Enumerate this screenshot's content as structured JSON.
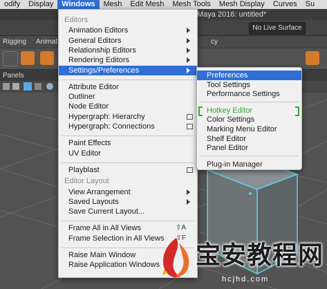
{
  "menubar": {
    "items": [
      "odify",
      "Display",
      "Windows",
      "Mesh",
      "Edit Mesh",
      "Mesh Tools",
      "Mesh Display",
      "Curves",
      "Su"
    ],
    "active_index": 2
  },
  "window_title": "Maya 2016: untitled*",
  "toolbar": {
    "live_surface": "No Live Surface"
  },
  "shelf_tabs": [
    "Rigging",
    "Animat",
    "cy"
  ],
  "panels_label": "Panels",
  "main_menu": {
    "sections": [
      {
        "header": "Editors",
        "items": [
          {
            "label": "Animation Editors",
            "kind": "submenu"
          },
          {
            "label": "General Editors",
            "kind": "submenu"
          },
          {
            "label": "Relationship Editors",
            "kind": "submenu"
          },
          {
            "label": "Rendering Editors",
            "kind": "submenu"
          },
          {
            "label": "Settings/Preferences",
            "kind": "submenu",
            "highlight": true
          }
        ]
      },
      {
        "header": "",
        "items": [
          {
            "label": "Attribute Editor"
          },
          {
            "label": "Outliner"
          },
          {
            "label": "Node Editor"
          },
          {
            "label": "Hypergraph: Hierarchy",
            "kind": "option"
          },
          {
            "label": "Hypergraph: Connections",
            "kind": "option"
          }
        ]
      },
      {
        "header": "",
        "items": [
          {
            "label": "Paint Effects"
          },
          {
            "label": "UV Editor"
          }
        ]
      },
      {
        "header": "",
        "items": [
          {
            "label": "Playblast",
            "kind": "option"
          }
        ]
      },
      {
        "header": "Editor Layout",
        "items": [
          {
            "label": "View Arrangement",
            "kind": "submenu"
          },
          {
            "label": "Saved Layouts",
            "kind": "submenu"
          },
          {
            "label": "Save Current Layout..."
          }
        ]
      },
      {
        "header": "",
        "items": [
          {
            "label": "Frame All in All Views",
            "shortcut": "⇧A"
          },
          {
            "label": "Frame Selection in All Views",
            "shortcut": "⇧F"
          }
        ]
      },
      {
        "header": "",
        "items": [
          {
            "label": "Raise Main Window"
          },
          {
            "label": "Raise Application Windows"
          }
        ]
      }
    ]
  },
  "sub_menu": {
    "groups": [
      [
        {
          "label": "Preferences",
          "highlight": true
        },
        {
          "label": "Tool Settings"
        },
        {
          "label": "Performance Settings"
        }
      ],
      [
        {
          "label": "Hotkey Editor",
          "green": true
        },
        {
          "label": "Color Settings"
        },
        {
          "label": "Marking Menu Editor"
        },
        {
          "label": "Shelf Editor"
        },
        {
          "label": "Panel Editor"
        }
      ],
      [
        {
          "label": "Plug-in Manager"
        }
      ]
    ]
  },
  "colors": {
    "menu_highlight": "#2f6fd6",
    "hotkey_green": "#3aa53a",
    "cube_edge": "#5fd0e8"
  },
  "watermark": {
    "title": "宝安教程网",
    "url": "hcjhd.com"
  }
}
